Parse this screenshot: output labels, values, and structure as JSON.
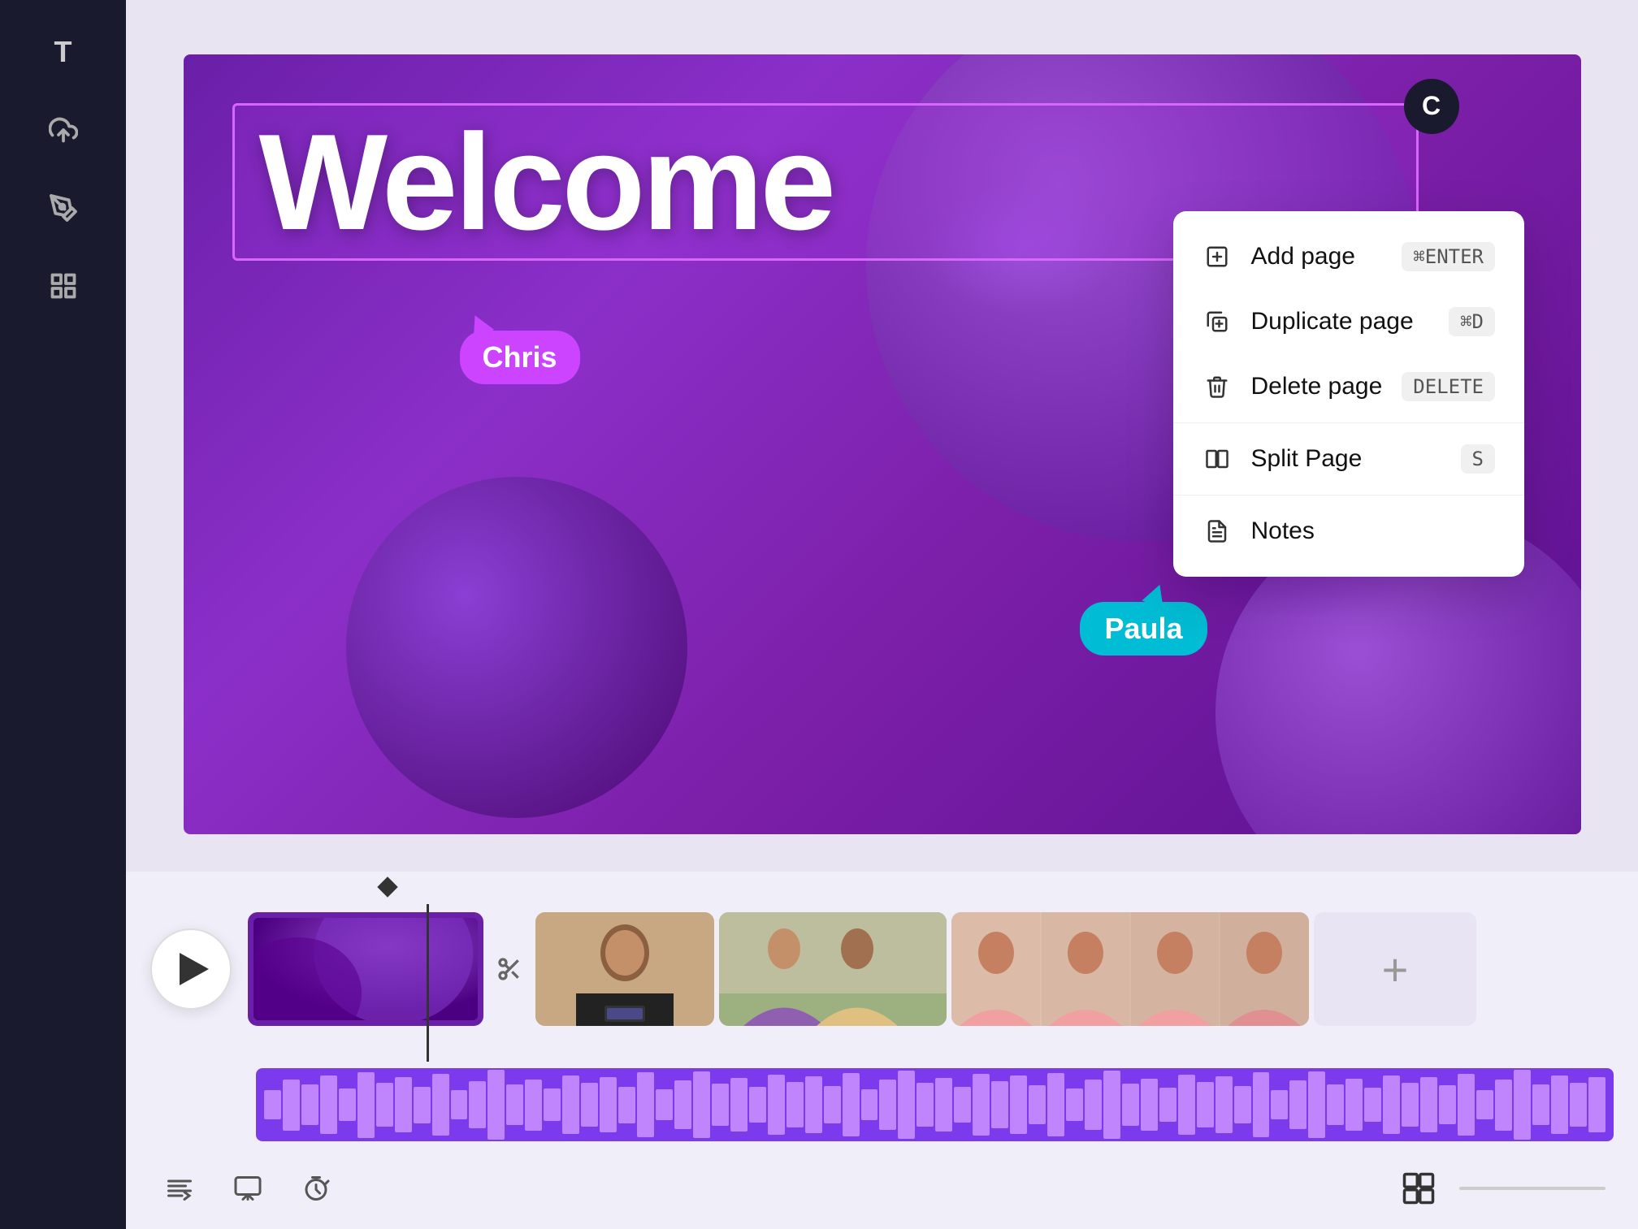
{
  "sidebar": {
    "icons": [
      {
        "name": "text-icon",
        "symbol": "T"
      },
      {
        "name": "upload-icon",
        "symbol": "↑"
      },
      {
        "name": "draw-icon",
        "symbol": "✏"
      },
      {
        "name": "grid-icon",
        "symbol": "⊞"
      }
    ]
  },
  "canvas": {
    "welcome_text": "Welcome",
    "c_avatar": "C",
    "background_color": "#7b2fbe"
  },
  "cursors": {
    "chris": {
      "label": "Chris",
      "color": "#cc44ff"
    },
    "paula": {
      "label": "Paula",
      "color": "#00bcd4"
    }
  },
  "context_menu": {
    "items": [
      {
        "label": "Add page",
        "shortcut": "⌘ENTER",
        "icon": "add-page"
      },
      {
        "label": "Duplicate page",
        "shortcut": "⌘D",
        "icon": "duplicate-page"
      },
      {
        "label": "Delete page",
        "shortcut": "DELETE",
        "icon": "delete-page"
      },
      {
        "label": "Split Page",
        "shortcut": "S",
        "icon": "split-page"
      },
      {
        "label": "Notes",
        "shortcut": "",
        "icon": "notes"
      }
    ]
  },
  "timeline": {
    "play_label": "▶",
    "add_clip_label": "+",
    "clips": [
      {
        "id": 1,
        "type": "purple-abstract"
      },
      {
        "id": 2,
        "type": "person-1"
      },
      {
        "id": 3,
        "type": "two-persons"
      },
      {
        "id": 4,
        "type": "person-pink"
      }
    ]
  },
  "toolbar": {
    "captions_icon": "≡",
    "preview_icon": "▷",
    "timer_icon": "⏱"
  }
}
